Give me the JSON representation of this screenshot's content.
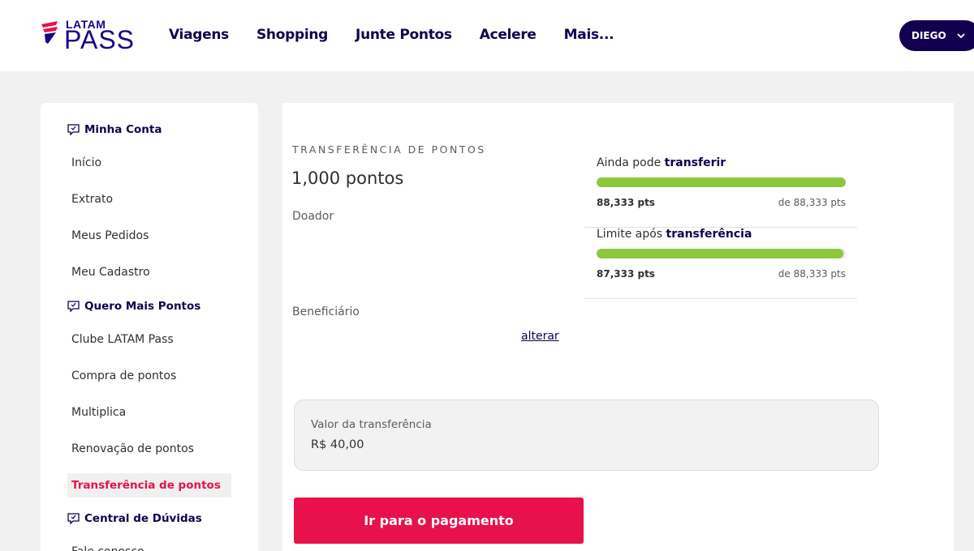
{
  "header": {
    "logo_top": "LATAM",
    "logo_main": "PASS",
    "nav": [
      "Viagens",
      "Shopping",
      "Junte Pontos",
      "Acelere",
      "Mais..."
    ],
    "user_name": "DIEGO"
  },
  "sidebar": {
    "sections": [
      {
        "title": "Minha Conta",
        "items": [
          "Início",
          "Extrato",
          "Meus Pedidos",
          "Meu Cadastro"
        ]
      },
      {
        "title": "Quero Mais Pontos",
        "items": [
          "Clube LATAM Pass",
          "Compra de pontos",
          "Multiplica",
          "Renovação de pontos",
          "Transferência de pontos"
        ]
      },
      {
        "title": "Central de Dúvidas",
        "items": [
          "Fale conosco"
        ]
      }
    ],
    "active_item": "Transferência de pontos"
  },
  "main": {
    "title": "TRANSFERÊNCIA DE PONTOS",
    "points": "1,000 pontos",
    "donor_label": "Doador",
    "beneficiary_label": "Beneficiário",
    "change_link": "alterar",
    "bars": [
      {
        "label_prefix": "Ainda pode ",
        "label_bold": "transferir",
        "value": "88,333 pts",
        "max": "de 88,333 pts",
        "fraction": 1.0
      },
      {
        "label_prefix": "Limite após ",
        "label_bold": "transferência",
        "value": "87,333 pts",
        "max": "de 88,333 pts",
        "fraction": 0.9887
      }
    ],
    "transfer_value_label": "Valor da transferência",
    "transfer_value": "R$ 40,00",
    "pay_button": "Ir para o pagamento"
  },
  "colors": {
    "brand_navy": "#10004f",
    "brand_red": "#e8114b",
    "progress_green": "#8dc63f"
  },
  "icons": [
    "latam-logo-icon",
    "chevron-down-icon",
    "chat-icon"
  ]
}
